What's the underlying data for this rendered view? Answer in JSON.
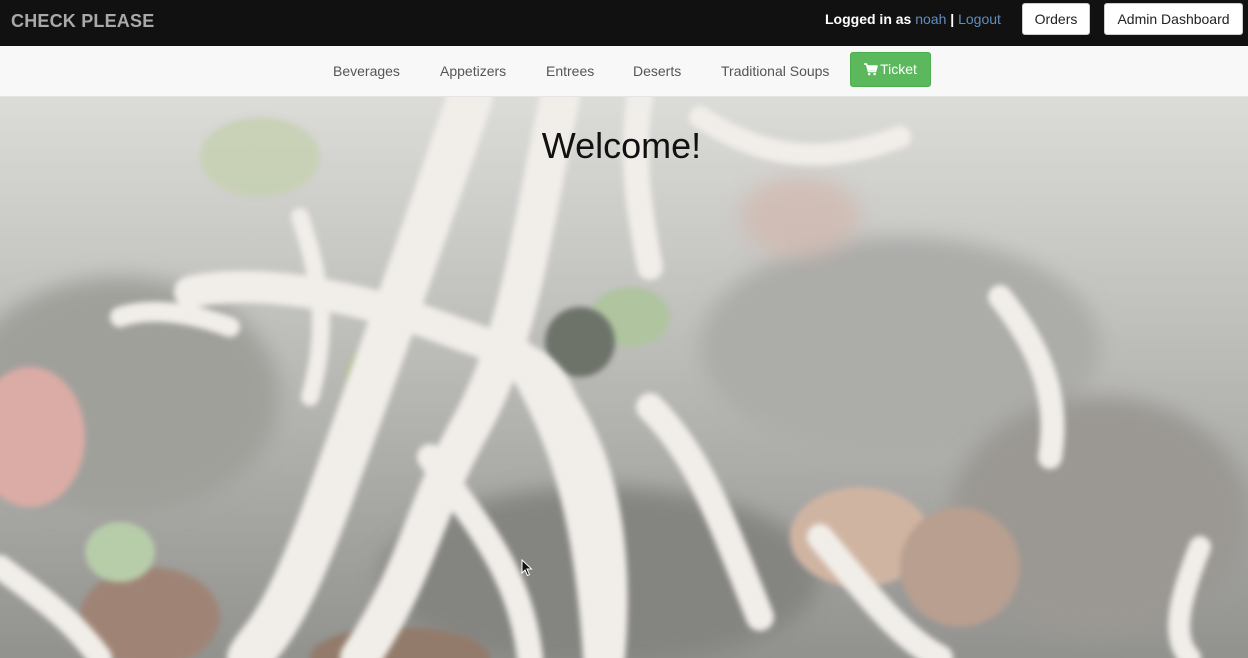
{
  "topbar": {
    "brand": "CHECK PLEASE",
    "logged_in_prefix": "Logged in as",
    "username": "noah",
    "separator": "|",
    "logout_label": "Logout",
    "orders_label": "Orders",
    "admin_label": "Admin Dashboard"
  },
  "subnav": {
    "items": [
      {
        "label": "Beverages"
      },
      {
        "label": "Appetizers"
      },
      {
        "label": "Entrees"
      },
      {
        "label": "Deserts"
      },
      {
        "label": "Traditional Soups"
      }
    ],
    "ticket_label": "Ticket",
    "ticket_icon": "cart-icon"
  },
  "hero": {
    "heading": "Welcome!",
    "background": "food-photo-noodles"
  },
  "colors": {
    "topbar_bg": "#111111",
    "brand": "#a9a9a9",
    "link": "#5f8fbf",
    "ticket_green": "#5cb85c"
  }
}
